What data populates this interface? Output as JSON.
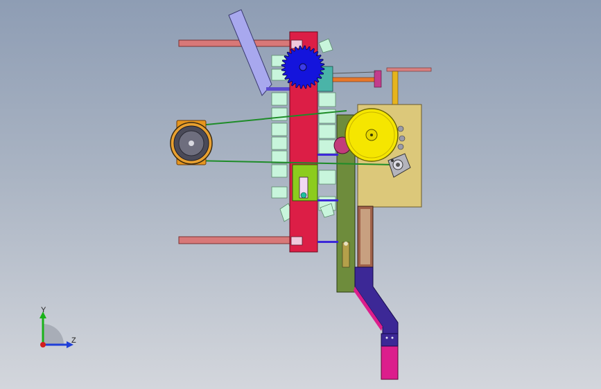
{
  "app": {
    "window_title": "",
    "view": "Front"
  },
  "triad": {
    "y_label": "Y",
    "z_label": "Z",
    "y_color": "#19b219",
    "z_color": "#1f3fd8",
    "x_color": "#d21e1e"
  },
  "colors": {
    "frame_red": "#dc1e46",
    "gear_blue": "#1414dc",
    "pulley_yellow": "#f5e600",
    "plate_tan": "#dcc87a",
    "olive_beam": "#6e8c3c",
    "motor_orange": "#e6961e",
    "belt_green": "#1e8c28",
    "arm_lavender": "#a0a0e6",
    "block_mint": "#c8f5dc",
    "chute_purple": "#3c2896",
    "chute_magenta": "#dc1e8c",
    "rod_salmon": "#d26e6e"
  }
}
